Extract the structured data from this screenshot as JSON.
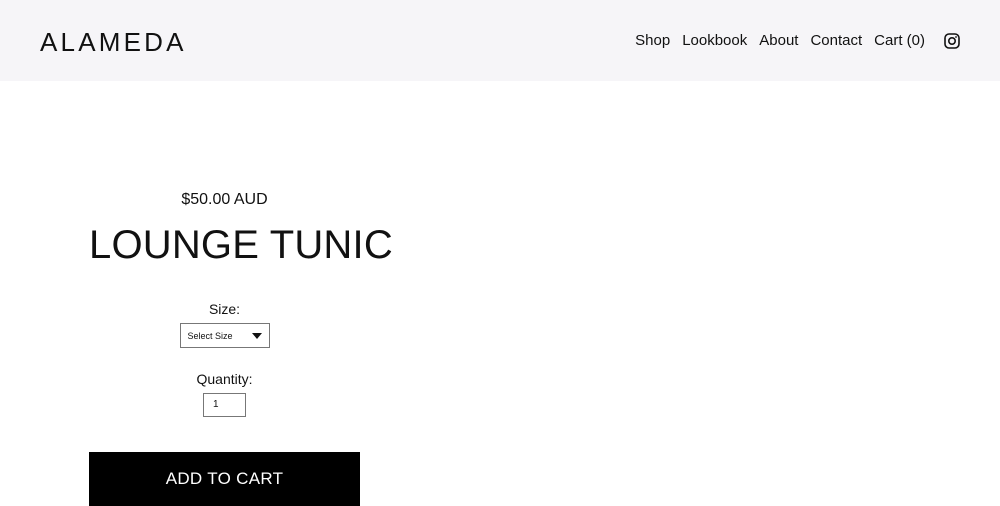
{
  "brand": {
    "name": "ALAMEDA"
  },
  "nav": {
    "items": [
      {
        "label": "Shop"
      },
      {
        "label": "Lookbook"
      },
      {
        "label": "About"
      },
      {
        "label": "Contact"
      },
      {
        "label": "Cart (0)"
      }
    ],
    "social_icon": "instagram-icon"
  },
  "product": {
    "price": "$50.00 AUD",
    "title": "LOUNGE TUNIC",
    "size_label": "Size:",
    "size_select_value": "Select Size",
    "quantity_label": "Quantity:",
    "quantity_value": "1",
    "add_to_cart_label": "ADD TO CART"
  },
  "colors": {
    "header_bg": "#f6f5f8",
    "button_bg": "#000000",
    "button_text": "#ffffff"
  }
}
